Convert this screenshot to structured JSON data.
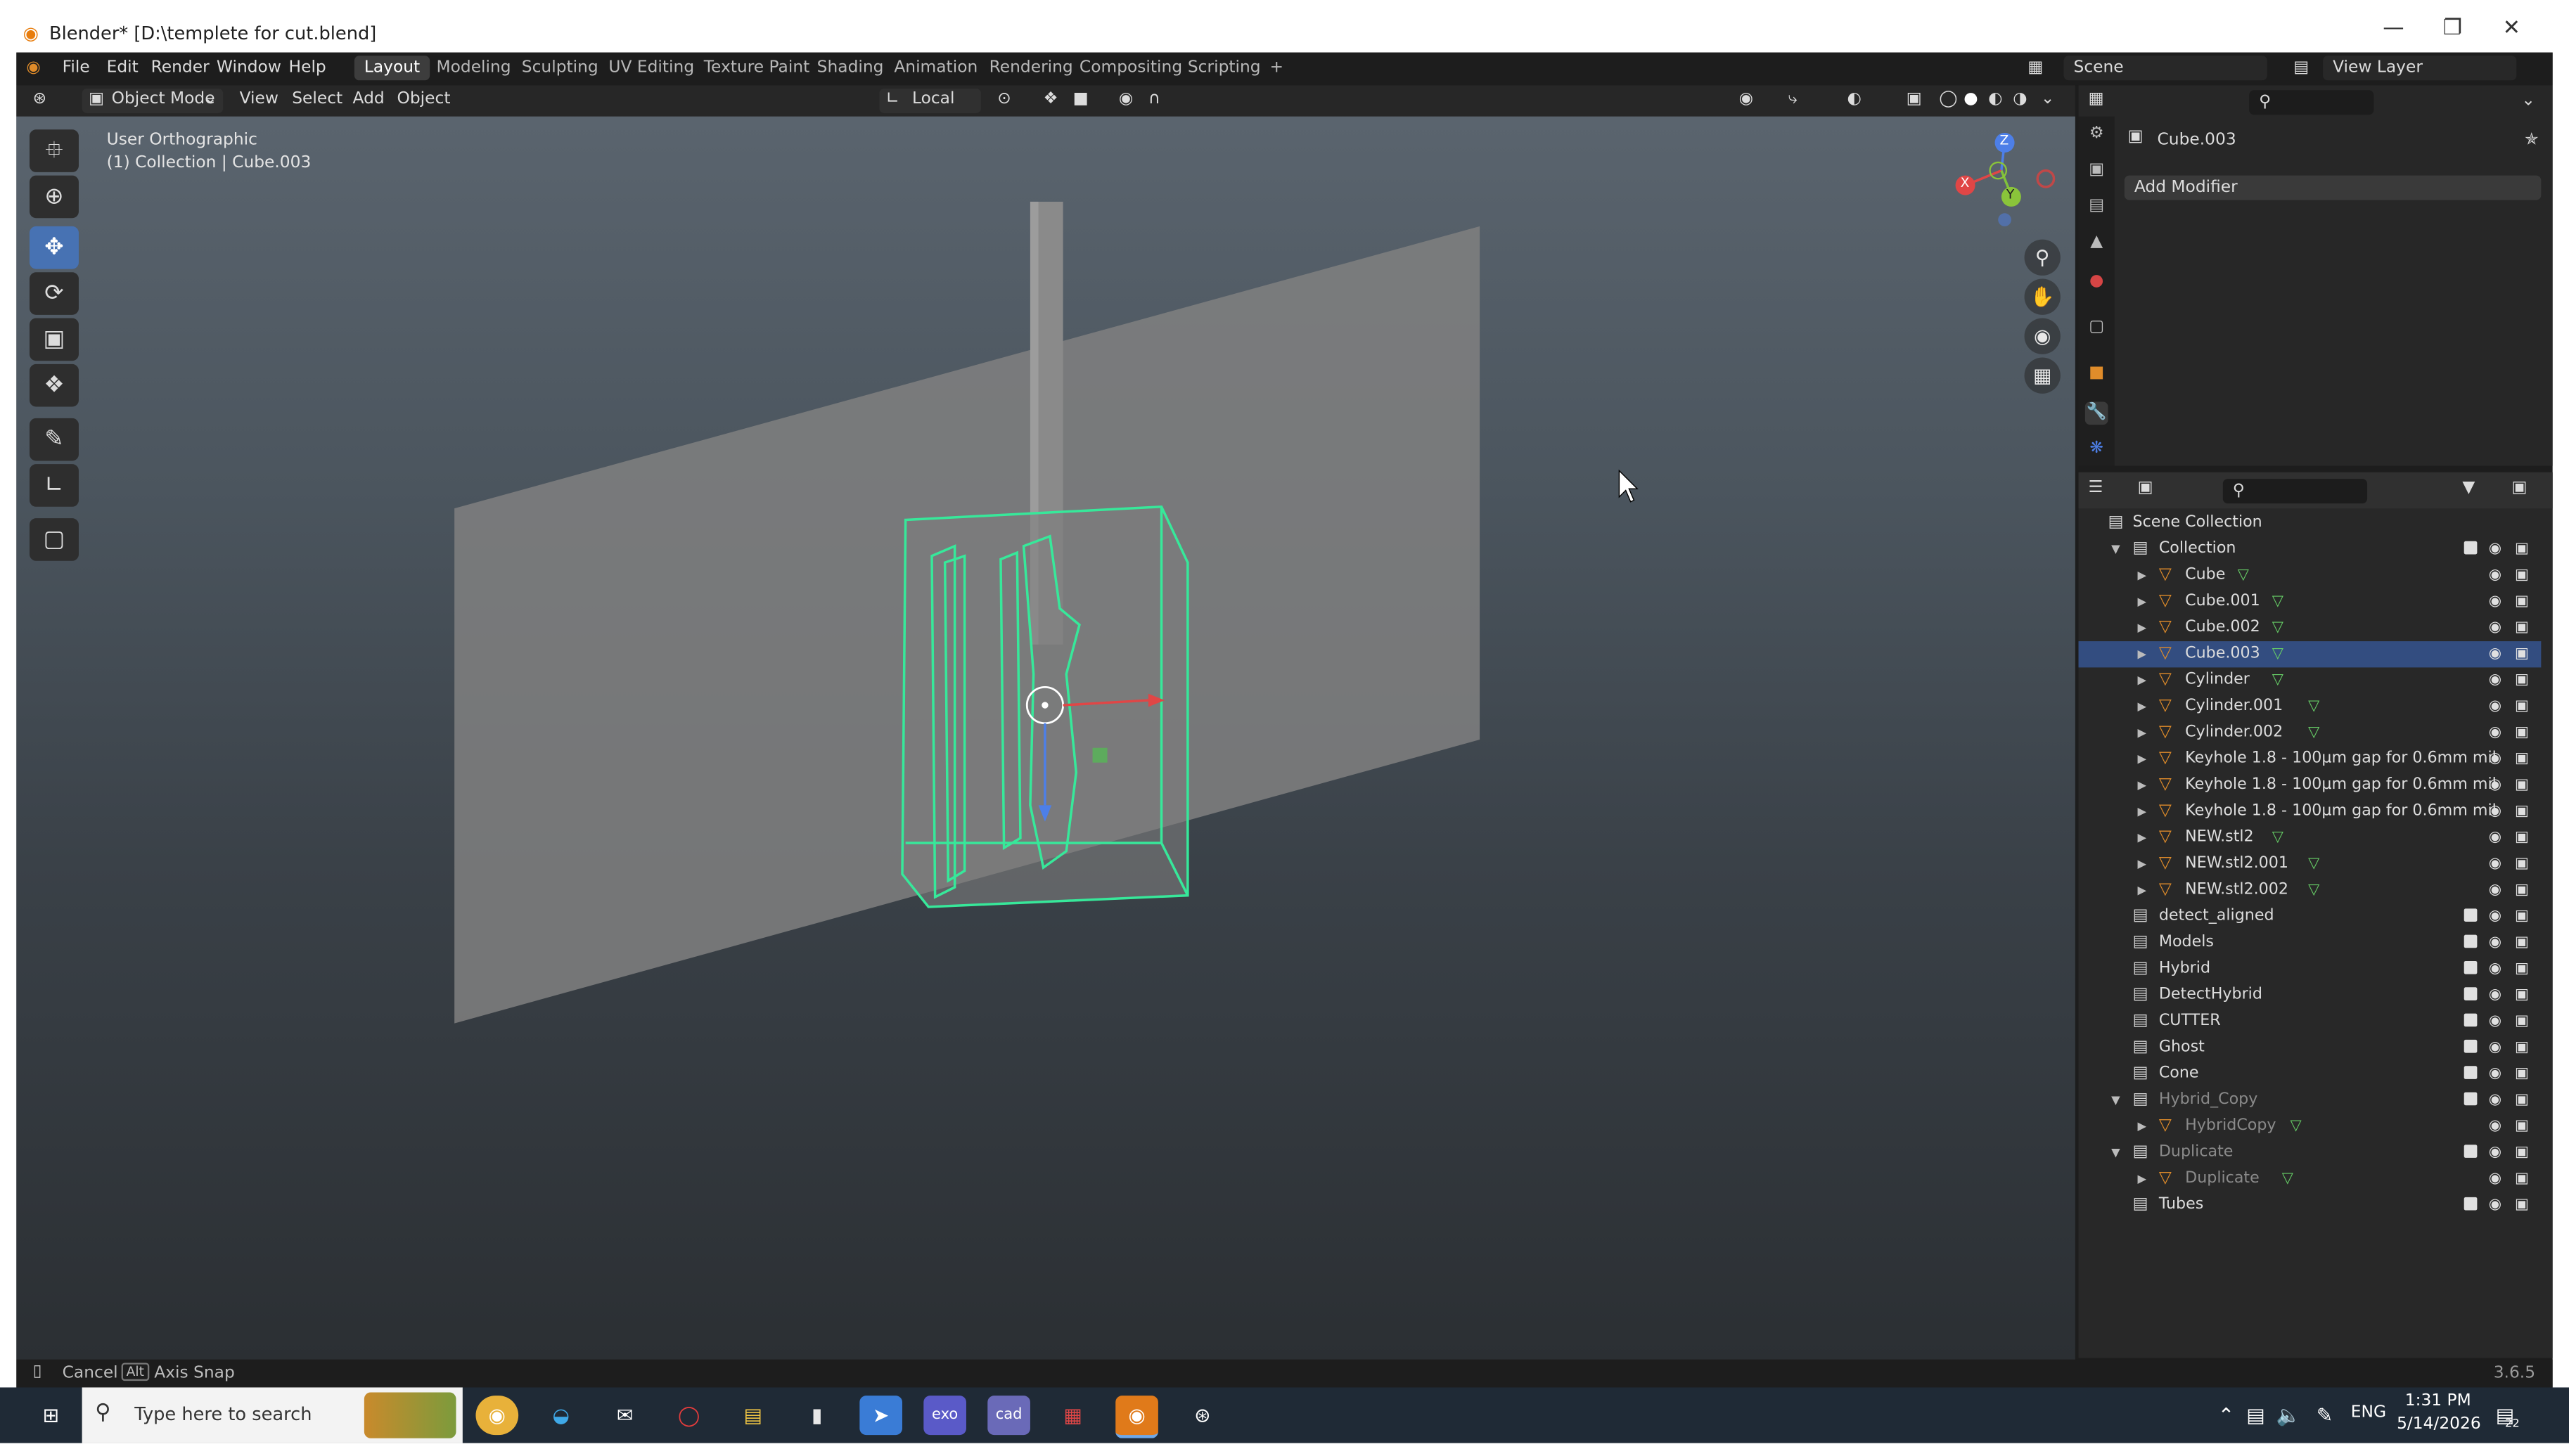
{
  "window": {
    "title": "Blender* [D:\\templete for cut.blend]",
    "controls": {
      "minimize": "—",
      "restore": "❐",
      "close": "✕"
    }
  },
  "menubar": {
    "items": [
      "File",
      "Edit",
      "Render",
      "Window",
      "Help"
    ],
    "workspaces": [
      "Layout",
      "Modeling",
      "Sculpting",
      "UV Editing",
      "Texture Paint",
      "Shading",
      "Animation",
      "Rendering",
      "Compositing",
      "Scripting"
    ],
    "active_workspace": "Layout",
    "add_tab": "+",
    "scene": "Scene",
    "view_layer": "View Layer"
  },
  "viewport_header": {
    "mode": "Object Mode",
    "menus": [
      "View",
      "Select",
      "Add",
      "Object"
    ],
    "transform_orientation": "Local"
  },
  "viewport": {
    "view_name": "User Orthographic",
    "collection_info": "(1) Collection | Cube.003",
    "gizmo_axes": {
      "x": "X",
      "y": "Y",
      "z": "Z"
    }
  },
  "properties": {
    "object_name": "Cube.003",
    "add_modifier": "Add Modifier"
  },
  "outliner": {
    "root": "Scene Collection",
    "rows": [
      {
        "label": "Collection",
        "kind": "collection",
        "level": 1,
        "expanded": true,
        "checkbox": true
      },
      {
        "label": "Cube",
        "kind": "object",
        "level": 2,
        "mesh": true
      },
      {
        "label": "Cube.001",
        "kind": "object",
        "level": 2,
        "mesh": true
      },
      {
        "label": "Cube.002",
        "kind": "object",
        "level": 2,
        "mesh": true
      },
      {
        "label": "Cube.003",
        "kind": "object",
        "level": 2,
        "mesh": true,
        "selected": true
      },
      {
        "label": "Cylinder",
        "kind": "object",
        "level": 2,
        "mesh": true
      },
      {
        "label": "Cylinder.001",
        "kind": "object",
        "level": 2,
        "mesh": true
      },
      {
        "label": "Cylinder.002",
        "kind": "object",
        "level": 2,
        "mesh": true
      },
      {
        "label": "Keyhole 1.8 - 100µm gap for 0.6mm mil",
        "kind": "object",
        "level": 2,
        "mesh": false
      },
      {
        "label": "Keyhole 1.8 - 100µm gap for 0.6mm mil",
        "kind": "object",
        "level": 2,
        "mesh": false
      },
      {
        "label": "Keyhole 1.8 - 100µm gap for 0.6mm mil",
        "kind": "object",
        "level": 2,
        "mesh": false
      },
      {
        "label": "NEW.stl2",
        "kind": "object",
        "level": 2,
        "mesh": true
      },
      {
        "label": "NEW.stl2.001",
        "kind": "object",
        "level": 2,
        "mesh": true
      },
      {
        "label": "NEW.stl2.002",
        "kind": "object",
        "level": 2,
        "mesh": true
      },
      {
        "label": "detect_aligned",
        "kind": "collection",
        "level": 1,
        "checkbox": true
      },
      {
        "label": "Models",
        "kind": "collection",
        "level": 1,
        "checkbox": true
      },
      {
        "label": "Hybrid",
        "kind": "collection",
        "level": 1,
        "checkbox": true
      },
      {
        "label": "DetectHybrid",
        "kind": "collection",
        "level": 1,
        "checkbox": true
      },
      {
        "label": "CUTTER",
        "kind": "collection",
        "level": 1,
        "checkbox": true
      },
      {
        "label": "Ghost",
        "kind": "collection",
        "level": 1,
        "checkbox": true
      },
      {
        "label": "Cone",
        "kind": "collection",
        "level": 1,
        "checkbox": true
      },
      {
        "label": "Hybrid_Copy",
        "kind": "collection",
        "level": 1,
        "expanded": true,
        "checkbox": true,
        "dim": true
      },
      {
        "label": "HybridCopy",
        "kind": "object",
        "level": 2,
        "mesh": true,
        "dim": true
      },
      {
        "label": "Duplicate",
        "kind": "collection",
        "level": 1,
        "expanded": true,
        "checkbox": true,
        "dim": true
      },
      {
        "label": "Duplicate",
        "kind": "object",
        "level": 2,
        "mesh": true,
        "dim": true
      },
      {
        "label": "Tubes",
        "kind": "collection",
        "level": 1,
        "checkbox": true
      }
    ]
  },
  "statusbar": {
    "cancel": "Cancel",
    "alt_key": "Alt",
    "axis_snap": "Axis Snap",
    "version": "3.6.5"
  },
  "taskbar": {
    "search_placeholder": "Type here to search",
    "time": "1:31 PM",
    "date": "5/14/2026",
    "language": "ENG",
    "notifications": "22"
  },
  "colors": {
    "accent": "#4772b3",
    "selection_outline": "#37e89a",
    "object_icon": "#e08c2a",
    "mesh_data_icon": "#66cc66"
  }
}
